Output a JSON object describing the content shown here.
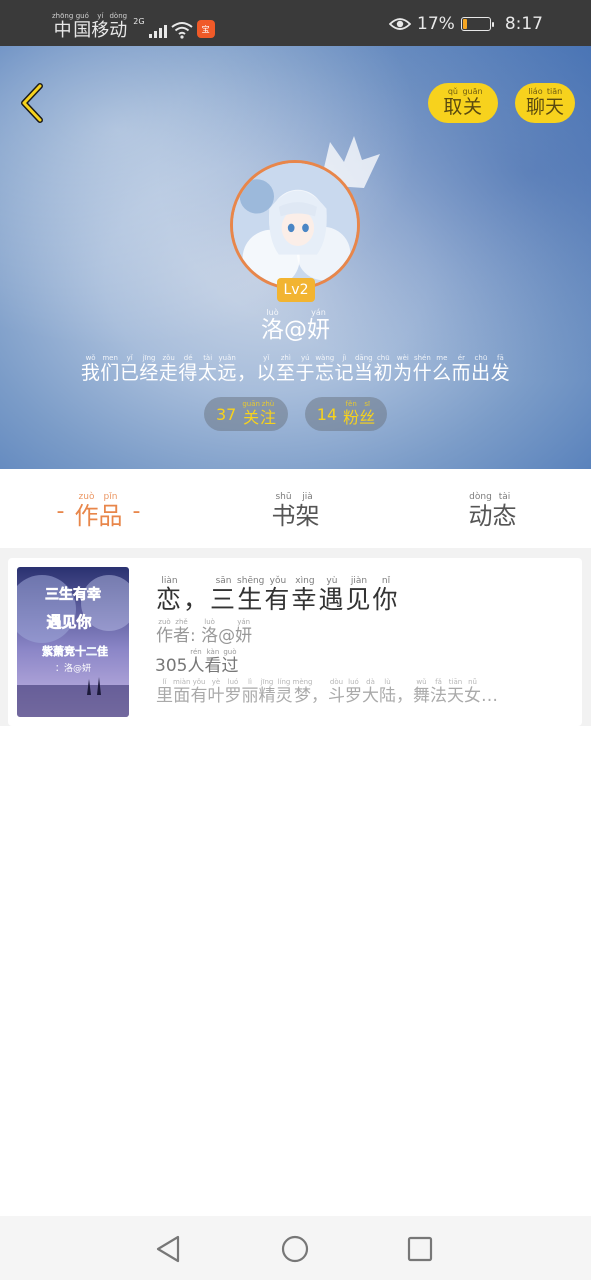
{
  "status_bar": {
    "carrier": [
      {
        "char": "中",
        "py": "zhōng"
      },
      {
        "char": "国",
        "py": "guó"
      },
      {
        "char": "移",
        "py": "yí"
      },
      {
        "char": "动",
        "py": "dòng"
      }
    ],
    "network": "2G",
    "app_badge": "宝",
    "battery": "17%",
    "battery_level": 0.17,
    "time": "8:17"
  },
  "header": {
    "unfollow": [
      {
        "char": "取",
        "py": "qǔ"
      },
      {
        "char": "关",
        "py": "guān"
      }
    ],
    "chat": [
      {
        "char": "聊",
        "py": "liáo"
      },
      {
        "char": "天",
        "py": "tiān"
      }
    ],
    "level": "Lv2",
    "username": [
      {
        "char": "洛",
        "py": "luò"
      },
      {
        "char": "@",
        "py": ""
      },
      {
        "char": "妍",
        "py": "yán"
      }
    ],
    "bio": [
      {
        "char": "我",
        "py": "wǒ"
      },
      {
        "char": "们",
        "py": "men"
      },
      {
        "char": "已",
        "py": "yǐ"
      },
      {
        "char": "经",
        "py": "jīng"
      },
      {
        "char": "走",
        "py": "zǒu"
      },
      {
        "char": "得",
        "py": "dé"
      },
      {
        "char": "太",
        "py": "tài"
      },
      {
        "char": "远",
        "py": "yuǎn"
      },
      {
        "char": "，",
        "py": ""
      },
      {
        "char": "以",
        "py": "yǐ"
      },
      {
        "char": "至",
        "py": "zhì"
      },
      {
        "char": "于",
        "py": "yú"
      },
      {
        "char": "忘",
        "py": "wàng"
      },
      {
        "char": "记",
        "py": "jì"
      },
      {
        "char": "当",
        "py": "dāng"
      },
      {
        "char": "初",
        "py": "chū"
      },
      {
        "char": "为",
        "py": "wèi"
      },
      {
        "char": "什",
        "py": "shén"
      },
      {
        "char": "么",
        "py": "me"
      },
      {
        "char": "而",
        "py": "ér"
      },
      {
        "char": "出",
        "py": "chū"
      },
      {
        "char": "发",
        "py": "fā"
      }
    ],
    "following_count": "37",
    "following_label": [
      {
        "char": "关",
        "py": "guān"
      },
      {
        "char": "注",
        "py": "zhù"
      }
    ],
    "fans_count": "14",
    "fans_label": [
      {
        "char": "粉",
        "py": "fěn"
      },
      {
        "char": "丝",
        "py": "sī"
      }
    ]
  },
  "tabs": [
    {
      "id": "works",
      "active": true,
      "chars": [
        {
          "char": "作",
          "py": "zuò"
        },
        {
          "char": "品",
          "py": "pǐn"
        }
      ]
    },
    {
      "id": "bookshelf",
      "active": false,
      "chars": [
        {
          "char": "书",
          "py": "shū"
        },
        {
          "char": "架",
          "py": "jià"
        }
      ]
    },
    {
      "id": "activity",
      "active": false,
      "chars": [
        {
          "char": "动",
          "py": "dòng"
        },
        {
          "char": "态",
          "py": "tài"
        }
      ]
    }
  ],
  "tab_dash": "-",
  "works": [
    {
      "cover_text": [
        "三生有幸",
        "遇见你",
        "紫萧竞十二佳",
        "：洛@妍"
      ],
      "title": [
        {
          "char": "恋",
          "py": "liàn"
        },
        {
          "char": "，",
          "py": ""
        },
        {
          "char": "三",
          "py": "sān"
        },
        {
          "char": "生",
          "py": "shēng"
        },
        {
          "char": "有",
          "py": "yǒu"
        },
        {
          "char": "幸",
          "py": "xìng"
        },
        {
          "char": "遇",
          "py": "yù"
        },
        {
          "char": "见",
          "py": "jiàn"
        },
        {
          "char": "你",
          "py": "nǐ"
        }
      ],
      "author": [
        {
          "char": "作",
          "py": "zuò"
        },
        {
          "char": "者",
          "py": "zhě"
        },
        {
          "char": ": ",
          "py": ""
        },
        {
          "char": "洛",
          "py": "luò"
        },
        {
          "char": "@",
          "py": ""
        },
        {
          "char": "妍",
          "py": "yán"
        }
      ],
      "views": [
        {
          "char": "305",
          "py": ""
        },
        {
          "char": "人",
          "py": "rén"
        },
        {
          "char": "看",
          "py": "kàn"
        },
        {
          "char": "过",
          "py": "guò"
        }
      ],
      "desc": [
        {
          "char": "里",
          "py": "lǐ"
        },
        {
          "char": "面",
          "py": "miàn"
        },
        {
          "char": "有",
          "py": "yǒu"
        },
        {
          "char": "叶",
          "py": "yè"
        },
        {
          "char": "罗",
          "py": "luó"
        },
        {
          "char": "丽",
          "py": "lì"
        },
        {
          "char": "精",
          "py": "jīng"
        },
        {
          "char": "灵",
          "py": "líng"
        },
        {
          "char": "梦",
          "py": "mèng"
        },
        {
          "char": "，",
          "py": ""
        },
        {
          "char": "斗",
          "py": "dòu"
        },
        {
          "char": "罗",
          "py": "luó"
        },
        {
          "char": "大",
          "py": "dà"
        },
        {
          "char": "陆",
          "py": "lù"
        },
        {
          "char": "，",
          "py": ""
        },
        {
          "char": "舞",
          "py": "wǔ"
        },
        {
          "char": "法",
          "py": "fǎ"
        },
        {
          "char": "天",
          "py": "tiān"
        },
        {
          "char": "女",
          "py": "nǚ"
        },
        {
          "char": "…",
          "py": ""
        }
      ]
    }
  ],
  "colors": {
    "accent_orange": "#e8864a",
    "button_yellow": "#f7d21d",
    "header_blue": "#4f7ab8"
  }
}
